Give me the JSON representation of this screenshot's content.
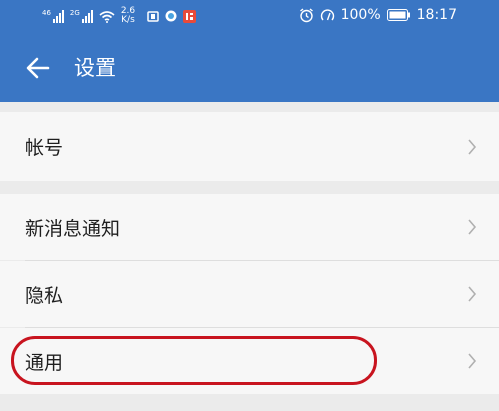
{
  "status_bar": {
    "signal1_label": "46",
    "signal2_label": "2G",
    "speed_value": "2.6",
    "speed_unit": "K/s",
    "battery": "100%",
    "time": "18:17"
  },
  "app_bar": {
    "title": "设置"
  },
  "settings": {
    "items": [
      {
        "label": "帐号"
      },
      {
        "label": "新消息通知"
      },
      {
        "label": "隐私"
      },
      {
        "label": "通用"
      }
    ]
  },
  "colors": {
    "header": "#3a76c4",
    "highlight": "#c8141f"
  }
}
